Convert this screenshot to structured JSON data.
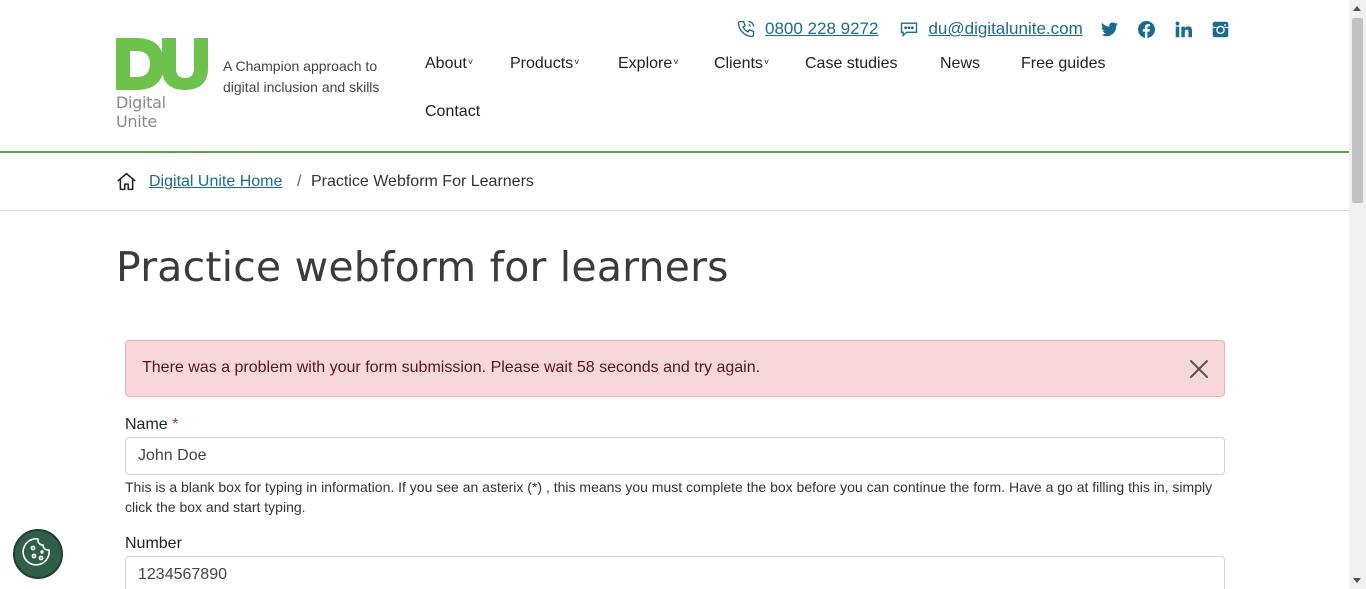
{
  "header": {
    "logo_letters": "DU",
    "logo_word": "Digital Unite",
    "tagline": "A Champion approach to digital inclusion and skills",
    "phone": "0800 228 9272",
    "email": "du@digitalunite.com",
    "social": [
      "twitter-icon",
      "facebook-icon",
      "linkedin-icon",
      "instagram-icon"
    ],
    "brand_color": "#6cc24a",
    "link_color": "#1b6a8f"
  },
  "nav": {
    "about": "About",
    "products": "Products",
    "explore": "Explore",
    "clients": "Clients",
    "case_studies": "Case studies",
    "news": "News",
    "free_guides": "Free guides",
    "contact": "Contact",
    "dropdown_chevron": "˅"
  },
  "breadcrumb": {
    "home": "Digital Unite Home",
    "separator": "/",
    "current": "Practice Webform For Learners"
  },
  "page": {
    "title": "Practice webform for learners"
  },
  "alert": {
    "message": "There was a problem with your form submission. Please wait 58 seconds and try again.",
    "background": "#f8d7da"
  },
  "form": {
    "name_label": "Name",
    "required_mark": "*",
    "name_value": "John Doe",
    "name_help": "This is a blank box for typing in information. If you see an asterix (*) , this means you must complete the box before you can continue the form. Have a go at filling this in, simply click the box and start typing.",
    "number_label": "Number",
    "number_value": "1234567890"
  },
  "cookie": {
    "icon": "cookie-icon"
  }
}
